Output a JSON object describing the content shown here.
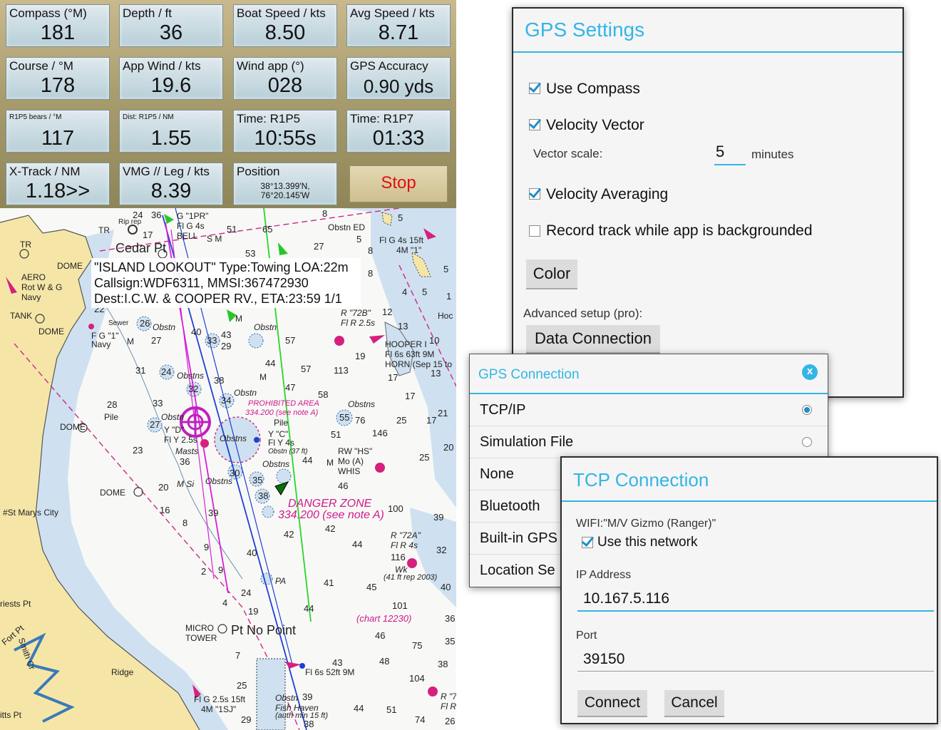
{
  "instruments": {
    "tiles": [
      {
        "label": "Compass (°M)",
        "value": "181"
      },
      {
        "label": "Depth / ft",
        "value": "36"
      },
      {
        "label": "Boat Speed / kts",
        "value": "8.50"
      },
      {
        "label": "Avg Speed / kts",
        "value": "8.71"
      },
      {
        "label": "Course / °M",
        "value": "178"
      },
      {
        "label": "App Wind / kts",
        "value": "19.6"
      },
      {
        "label": "Wind app (°)",
        "value": "028"
      },
      {
        "label": "GPS Accuracy",
        "value": "0.90 yds"
      },
      {
        "label": "R1P5 bears / °M",
        "value": "117"
      },
      {
        "label": "Dist: R1P5 / NM",
        "value": "1.55"
      },
      {
        "label": "Time: R1P5",
        "value": "10:55s"
      },
      {
        "label": "Time: R1P7",
        "value": "01:33"
      },
      {
        "label": "X-Track / NM",
        "value": "1.18>>"
      },
      {
        "label": "VMG // Leg / kts",
        "value": "8.39"
      },
      {
        "label": "Position",
        "value_line1": "38°13.399'N,",
        "value_line2": "76°20.145'W"
      }
    ],
    "stop_label": "Stop"
  },
  "chart": {
    "popup": {
      "line1": "\"ISLAND LOOKOUT\" Type:Towing LOA:22m",
      "line2": "Callsign:WDF6311, MMSI:367472930",
      "line3": "Dest:I.C.W. & COOPER RV., ETA:23:59 1/1"
    },
    "labels": {
      "cedar_pt": "Cedar Pt",
      "tr": "TR",
      "dome": "DOME",
      "aero": "AERO",
      "rot_wg": "Rot W & G",
      "navy": "Navy",
      "tank": "TANK",
      "fg1": "F G \"1\"",
      "g1pr": "G \"1PR\"",
      "flg4s": "Fl G 4s",
      "bell": "BELL",
      "obstn": "Obstn",
      "obstns": "Obstns",
      "pile": "Pile",
      "prohibited1": "PROHIBITED AREA",
      "prohibited2": "334.200 (see note A)",
      "danger1": "DANGER ZONE",
      "danger2": "334.200 (see note A)",
      "hooper1": "HOOPER I",
      "hooper2": "Fl 6s 63ft 9M",
      "hooper3": "HORN (Sep 15 to",
      "r72b1": "R \"72B\"",
      "r72b2": "Fl R 2.5s",
      "r72a1": "R \"72A\"",
      "r72a2": "Fl R 4s",
      "rwhs1": "RW \"HS\"",
      "rwhs2": "Mo (A)",
      "rwhs3": "WHIS",
      "ycd": "Y \"C\"",
      "fly4s": "Fl Y 4s",
      "yd": "Y \"D\"",
      "fly25": "Fl Y 2.5s",
      "st_marys": "#St Marys City",
      "priests_pt": "riests Pt",
      "fort_pt": "Fort Pt",
      "smith_cr": "Smith Cr",
      "micro1": "MICRO",
      "micro2": "TOWER",
      "pt_no_point": "Pt No Point",
      "ridge": "Ridge",
      "flg25": "Fl G 2.5s 15ft",
      "m1sj": "4M \"1SJ\"",
      "fl6s": "Fl 6s 52ft 9M",
      "fish_haven1": "Fish Haven",
      "fish_haven2": "(auth min 15 ft)",
      "chart12230": "(chart 12230)",
      "rep2003": "(41 ft rep 2003)",
      "flg4s15": "Fl G 4s 15ft",
      "m1": "4M \"1\"",
      "masts": "Masts",
      "wk": "Wk",
      "sewer": "Sewer",
      "hoc": "Hoc",
      "itts_pt": "itts Pt",
      "sm": "S M",
      "m": "M",
      "msi": "M Si",
      "pa": "PA",
      "obstned": "Obstn ED",
      "obstn37": "Obstn (37 ft)",
      "ripr": "Rip rep",
      "r7": "R \"7",
      "flr": "Fl R"
    },
    "soundings": [
      "24",
      "36",
      "17",
      "51",
      "65",
      "8",
      "53",
      "27",
      "5",
      "8",
      "5",
      "5",
      "8",
      "4",
      "5",
      "1",
      "22",
      "26",
      "40",
      "43",
      "57",
      "12",
      "13",
      "10",
      "27",
      "33",
      "29",
      "44",
      "57",
      "47",
      "113",
      "19",
      "17",
      "13",
      "31",
      "24",
      "32",
      "38",
      "34",
      "58",
      "17",
      "17",
      "21",
      "28",
      "33",
      "27",
      "55",
      "76",
      "25",
      "146",
      "20",
      "23",
      "36",
      "44",
      "51",
      "25",
      "30",
      "35",
      "46",
      "20",
      "38",
      "16",
      "39",
      "100",
      "39",
      "8",
      "42",
      "42",
      "44",
      "9",
      "40",
      "116",
      "32",
      "2",
      "9",
      "4",
      "24",
      "41",
      "45",
      "40",
      "19",
      "44",
      "101",
      "36",
      "46",
      "75",
      "35",
      "7",
      "43",
      "48",
      "38",
      "104",
      "25",
      "39",
      "44",
      "51",
      "74",
      "26",
      "29",
      "38"
    ]
  },
  "gps_settings": {
    "title": "GPS Settings",
    "use_compass": "Use Compass",
    "velocity_vector": "Velocity Vector",
    "vector_scale_label": "Vector scale:",
    "vector_scale_value": "5",
    "minutes": "minutes",
    "velocity_averaging": "Velocity Averaging",
    "record_track": "Record track while app is backgrounded",
    "color_button": "Color",
    "advanced_label": "Advanced setup (pro):",
    "data_connection_button": "Data Connection"
  },
  "gps_connection": {
    "title": "GPS Connection",
    "close": "x",
    "options": [
      "TCP/IP",
      "Simulation File",
      "None",
      "Bluetooth",
      "Built-in GPS",
      "Location Se"
    ]
  },
  "tcp_connection": {
    "title": "TCP Connection",
    "wifi": "WIFI:\"M/V Gizmo (Ranger)\"",
    "use_network": "Use this network",
    "ip_label": "IP Address",
    "ip_value": "10.167.5.116",
    "port_label": "Port",
    "port_value": "39150",
    "connect": "Connect",
    "cancel": "Cancel"
  }
}
